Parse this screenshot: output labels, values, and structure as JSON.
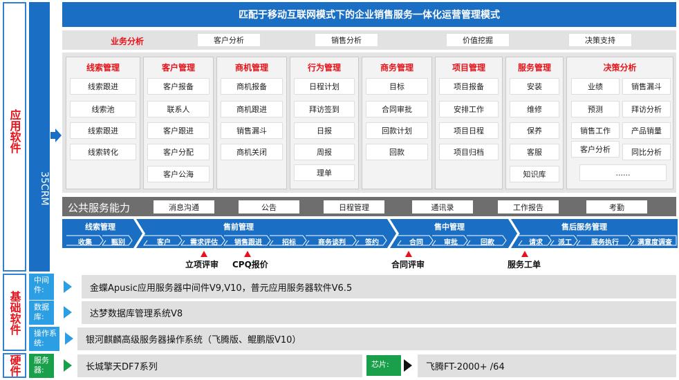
{
  "side": {
    "app": "应用软件",
    "base": "基础软件",
    "hw": "硬件"
  },
  "crm": "35CRM",
  "title": "匹配于移动互联网模式下的企业销售服务一体化运营管理模式",
  "analysis": {
    "label": "业务分析",
    "items": [
      "客户分析",
      "销售分析",
      "价值挖掘",
      "决策支持"
    ]
  },
  "modules": [
    {
      "title": "线索管理",
      "items": [
        "线索跟进",
        "线索池",
        "线索跟进",
        "线索转化"
      ]
    },
    {
      "title": "客户管理",
      "items": [
        "客户报备",
        "联系人",
        "客户跟进",
        "客户分配",
        "客户公海"
      ]
    },
    {
      "title": "商机管理",
      "items": [
        "商机报备",
        "商机跟进",
        "销售漏斗",
        "商机关闭"
      ]
    },
    {
      "title": "行为管理",
      "items": [
        "日程计划",
        "拜访签到",
        "日报",
        "周报",
        "理单"
      ]
    },
    {
      "title": "商务管理",
      "items": [
        "目标",
        "合同审批",
        "回款计划",
        "回款"
      ]
    },
    {
      "title": "项目管理",
      "items": [
        "项目报备",
        "安排工作",
        "项目日程",
        "项目归档"
      ]
    },
    {
      "title": "服务管理",
      "items": [
        "安装",
        "维修",
        "保养",
        "客服",
        "知识库"
      ]
    },
    {
      "title": "决策分析",
      "items": [
        "业绩",
        "销售漏斗",
        "预测",
        "拜访分析",
        "销售工作",
        "产品销量",
        "客户分析",
        "同比分析",
        "......"
      ]
    }
  ],
  "public": {
    "label": "公共服务能力",
    "items": [
      "消息沟通",
      "公告",
      "日程管理",
      "通讯录",
      "工作报告",
      "考勤"
    ]
  },
  "flow": {
    "stages": [
      {
        "title": "线索管理",
        "steps": [
          "收集",
          "甄别"
        ]
      },
      {
        "title": "售前管理",
        "steps": [
          "客户",
          "需求评估",
          "销售跟进",
          "招标",
          "商务谈判",
          "签约"
        ]
      },
      {
        "title": "售中管理",
        "steps": [
          "合同",
          "审批",
          "回款"
        ]
      },
      {
        "title": "售后服务管理",
        "steps": [
          "请求",
          "派工",
          "服务执行",
          "满意度调查"
        ]
      }
    ],
    "markers": [
      "立项评审",
      "CPQ报价",
      "合同评审",
      "服务工单"
    ]
  },
  "infra": {
    "middleware": {
      "label": "中间件:",
      "value": "金蝶Apusic应用服务器中间件V9,V10，普元应用服务器软件V6.5"
    },
    "database": {
      "label": "数据库:",
      "value": "达梦数据库管理系统V8"
    },
    "os": {
      "label": "操作系统:",
      "value": "银河麒麟高级服务器操作系统（飞腾版、鲲鹏版V10）"
    },
    "server": {
      "label": "服务器:",
      "value": "长城擎天DF7系列"
    },
    "chip": {
      "label": "芯片:",
      "value": "飞腾FT-2000+ /64"
    }
  },
  "colors": {
    "brand": "#1a6fc4",
    "accent": "#e8131a",
    "cyan": "#2c9ee4",
    "green": "#1aa04a",
    "gray": "#6e6e6e"
  }
}
